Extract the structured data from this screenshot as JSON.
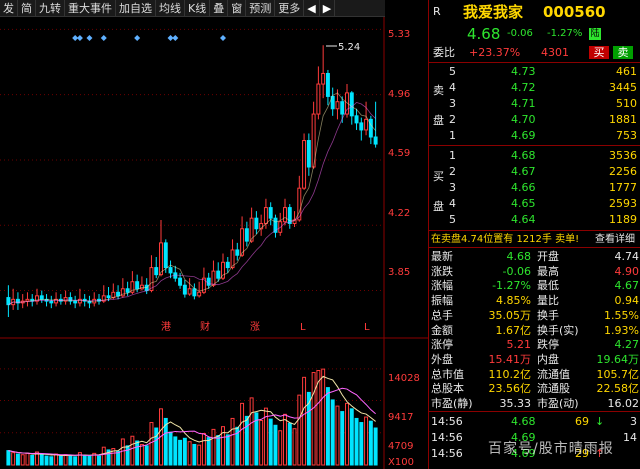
{
  "toolbar": {
    "items": [
      "发",
      "简",
      "九转",
      "重大事件",
      "加自选",
      "均线",
      "K线",
      "叠",
      "窗",
      "预测",
      "更多"
    ],
    "prev_nav": "◀",
    "next_nav": "▶"
  },
  "chart": {
    "price_ticks": [
      "5.33",
      "4.96",
      "4.59",
      "4.22",
      "3.85"
    ],
    "peak_label": "5.24",
    "event_marks": [
      "港",
      "财",
      "涨",
      "L",
      "L"
    ],
    "volume_ticks": [
      "14028",
      "9417",
      "4709",
      "X100"
    ],
    "colors": {
      "up": "#ff3b3b",
      "down": "#00e5ff",
      "grid": "#6b0000",
      "ma": "#f2e6a8",
      "tick": "#ff3b3b",
      "marker": "#5fb0ff"
    }
  },
  "chart_data": {
    "type": "candlestick",
    "ylim": [
      3.7,
      5.4
    ],
    "volume_ylim": [
      0,
      16500
    ],
    "peak": 5.24,
    "candles": [
      [
        3.81,
        3.77,
        3.88,
        3.7,
        2100
      ],
      [
        3.77,
        3.8,
        3.86,
        3.74,
        1800
      ],
      [
        3.8,
        3.78,
        3.84,
        3.74,
        1600
      ],
      [
        3.78,
        3.79,
        3.83,
        3.75,
        1500
      ],
      [
        3.79,
        3.8,
        3.84,
        3.76,
        1700
      ],
      [
        3.8,
        3.79,
        3.83,
        3.76,
        1400
      ],
      [
        3.79,
        3.82,
        3.86,
        3.77,
        1900
      ],
      [
        3.82,
        3.8,
        3.85,
        3.78,
        1500
      ],
      [
        3.8,
        3.79,
        3.83,
        3.76,
        1300
      ],
      [
        3.79,
        3.78,
        3.82,
        3.75,
        1200
      ],
      [
        3.78,
        3.8,
        3.84,
        3.76,
        1600
      ],
      [
        3.8,
        3.79,
        3.83,
        3.77,
        1300
      ],
      [
        3.79,
        3.81,
        3.85,
        3.77,
        1500
      ],
      [
        3.81,
        3.79,
        3.84,
        3.77,
        1400
      ],
      [
        3.79,
        3.78,
        3.82,
        3.75,
        1200
      ],
      [
        3.78,
        3.8,
        3.86,
        3.76,
        1800
      ],
      [
        3.8,
        3.79,
        3.83,
        3.76,
        1400
      ],
      [
        3.79,
        3.78,
        3.82,
        3.75,
        1300
      ],
      [
        3.78,
        3.8,
        3.84,
        3.76,
        1700
      ],
      [
        3.8,
        3.79,
        3.83,
        3.77,
        1300
      ],
      [
        3.79,
        3.82,
        3.88,
        3.78,
        2600
      ],
      [
        3.82,
        3.81,
        3.87,
        3.79,
        2200
      ],
      [
        3.81,
        3.84,
        3.89,
        3.8,
        2400
      ],
      [
        3.84,
        3.82,
        3.88,
        3.8,
        2000
      ],
      [
        3.82,
        3.86,
        3.92,
        3.81,
        3800
      ],
      [
        3.86,
        3.84,
        3.9,
        3.82,
        2800
      ],
      [
        3.84,
        3.9,
        3.96,
        3.83,
        4200
      ],
      [
        3.9,
        3.86,
        3.94,
        3.84,
        3500
      ],
      [
        3.86,
        3.88,
        3.93,
        3.85,
        3000
      ],
      [
        3.88,
        3.85,
        3.92,
        3.83,
        2800
      ],
      [
        3.85,
        3.98,
        4.05,
        3.84,
        6200
      ],
      [
        3.98,
        3.94,
        4.04,
        3.92,
        5400
      ],
      [
        3.94,
        4.12,
        4.25,
        3.93,
        8200
      ],
      [
        4.12,
        3.98,
        4.14,
        3.95,
        6800
      ],
      [
        3.98,
        3.95,
        4.02,
        3.92,
        4800
      ],
      [
        3.95,
        3.92,
        3.99,
        3.9,
        4100
      ],
      [
        3.92,
        3.88,
        3.95,
        3.86,
        3600
      ],
      [
        3.88,
        3.83,
        3.91,
        3.81,
        3900
      ],
      [
        3.83,
        3.86,
        3.92,
        3.82,
        3400
      ],
      [
        3.86,
        3.82,
        3.89,
        3.8,
        3000
      ],
      [
        3.82,
        3.84,
        3.9,
        3.81,
        2900
      ],
      [
        3.84,
        3.92,
        3.98,
        3.83,
        4600
      ],
      [
        3.92,
        3.88,
        3.95,
        3.86,
        4000
      ],
      [
        3.88,
        3.96,
        4.02,
        3.87,
        5200
      ],
      [
        3.96,
        3.92,
        4.01,
        3.9,
        4300
      ],
      [
        3.92,
        4.01,
        4.06,
        3.91,
        5600
      ],
      [
        4.01,
        3.98,
        4.04,
        3.95,
        4400
      ],
      [
        3.98,
        4.08,
        4.14,
        3.97,
        6800
      ],
      [
        4.08,
        4.05,
        4.12,
        4.02,
        5500
      ],
      [
        4.05,
        4.2,
        4.27,
        4.04,
        9000
      ],
      [
        4.2,
        4.13,
        4.24,
        4.1,
        7100
      ],
      [
        4.13,
        4.26,
        4.32,
        4.12,
        9800
      ],
      [
        4.26,
        4.2,
        4.3,
        4.17,
        7600
      ],
      [
        4.2,
        4.23,
        4.28,
        4.16,
        6500
      ],
      [
        4.23,
        4.32,
        4.37,
        4.2,
        8300
      ],
      [
        4.32,
        4.26,
        4.35,
        4.22,
        6700
      ],
      [
        4.26,
        4.18,
        4.28,
        4.15,
        5800
      ],
      [
        4.18,
        4.24,
        4.29,
        4.16,
        5000
      ],
      [
        4.24,
        4.32,
        4.37,
        4.22,
        7400
      ],
      [
        4.32,
        4.23,
        4.34,
        4.2,
        6100
      ],
      [
        4.23,
        4.25,
        4.3,
        4.21,
        5300
      ],
      [
        4.25,
        4.43,
        4.5,
        4.24,
        10200
      ],
      [
        4.43,
        4.7,
        4.74,
        4.42,
        12800
      ],
      [
        4.7,
        4.55,
        4.74,
        4.5,
        10600
      ],
      [
        4.55,
        4.85,
        4.92,
        4.54,
        13500
      ],
      [
        4.85,
        5.02,
        5.12,
        4.82,
        13800
      ],
      [
        5.02,
        5.08,
        5.24,
        4.94,
        14000
      ],
      [
        5.08,
        4.95,
        5.1,
        4.9,
        11300
      ],
      [
        4.95,
        4.88,
        5.0,
        4.84,
        9500
      ],
      [
        4.88,
        4.92,
        4.99,
        4.82,
        8600
      ],
      [
        4.92,
        4.85,
        4.95,
        4.8,
        7800
      ],
      [
        4.85,
        4.97,
        5.02,
        4.83,
        9000
      ],
      [
        4.97,
        4.84,
        4.98,
        4.79,
        8200
      ],
      [
        4.84,
        4.8,
        4.88,
        4.76,
        6800
      ],
      [
        4.8,
        4.76,
        4.83,
        4.7,
        6200
      ],
      [
        4.76,
        4.82,
        4.92,
        4.73,
        7000
      ],
      [
        4.82,
        4.72,
        4.84,
        4.68,
        6400
      ],
      [
        4.72,
        4.68,
        4.92,
        4.66,
        5400
      ]
    ]
  },
  "quote": {
    "r_badge": "R",
    "name": "我爱我家",
    "code": "000560",
    "price": "4.68",
    "change": "-0.06",
    "change_pct": "-1.27%",
    "flag": "陆",
    "weibi_label": "委比",
    "weibi_value": "+23.37%",
    "weibi_diff": "4301",
    "buy_btn": "买",
    "sell_btn": "卖"
  },
  "order_book": {
    "sell_label_1": "卖",
    "sell_label_2": "盘",
    "buy_label_1": "买",
    "buy_label_2": "盘",
    "sell": [
      {
        "level": "5",
        "price": "4.73",
        "vol": "461"
      },
      {
        "level": "4",
        "price": "4.72",
        "vol": "3445"
      },
      {
        "level": "3",
        "price": "4.71",
        "vol": "510"
      },
      {
        "level": "2",
        "price": "4.70",
        "vol": "1881"
      },
      {
        "level": "1",
        "price": "4.69",
        "vol": "753"
      }
    ],
    "buy": [
      {
        "level": "1",
        "price": "4.68",
        "vol": "3536"
      },
      {
        "level": "2",
        "price": "4.67",
        "vol": "2256"
      },
      {
        "level": "3",
        "price": "4.66",
        "vol": "1777"
      },
      {
        "level": "4",
        "price": "4.65",
        "vol": "2593"
      },
      {
        "level": "5",
        "price": "4.64",
        "vol": "1189"
      }
    ]
  },
  "notice": {
    "text": "在卖盘4.74位置有 1212手 卖单!",
    "link": "查看详细"
  },
  "stats": [
    {
      "l1": "最新",
      "v1": "4.68",
      "c1": "green",
      "l2": "开盘",
      "v2": "4.74",
      "c2": "white"
    },
    {
      "l1": "涨跌",
      "v1": "-0.06",
      "c1": "green",
      "l2": "最高",
      "v2": "4.90",
      "c2": "red"
    },
    {
      "l1": "涨幅",
      "v1": "-1.27%",
      "c1": "green",
      "l2": "最低",
      "v2": "4.67",
      "c2": "green"
    },
    {
      "l1": "振幅",
      "v1": "4.85%",
      "c1": "yellow",
      "l2": "量比",
      "v2": "0.94",
      "c2": "yellow"
    },
    {
      "l1": "总手",
      "v1": "35.05万",
      "c1": "yellow",
      "l2": "换手",
      "v2": "1.55%",
      "c2": "yellow"
    },
    {
      "l1": "金额",
      "v1": "1.67亿",
      "c1": "yellow",
      "l2": "换手(实)",
      "v2": "1.93%",
      "c2": "yellow"
    },
    {
      "l1": "涨停",
      "v1": "5.21",
      "c1": "red",
      "l2": "跌停",
      "v2": "4.27",
      "c2": "green"
    },
    {
      "l1": "外盘",
      "v1": "15.41万",
      "c1": "red",
      "l2": "内盘",
      "v2": "19.64万",
      "c2": "green"
    },
    {
      "l1": "总市值",
      "v1": "110.2亿",
      "c1": "yellow",
      "l2": "流通值",
      "v2": "105.7亿",
      "c2": "yellow"
    },
    {
      "l1": "总股本",
      "v1": "23.56亿",
      "c1": "yellow",
      "l2": "流通股",
      "v2": "22.58亿",
      "c2": "yellow"
    },
    {
      "l1": "市盈(静)",
      "v1": "35.33",
      "c1": "white",
      "l2": "市盈(动)",
      "v2": "16.02",
      "c2": "white"
    }
  ],
  "ticks": [
    {
      "time": "14:56",
      "price": "4.68",
      "vol": "69",
      "arrow": "↓",
      "num": "3"
    },
    {
      "time": "14:56",
      "price": "4.69",
      "vol": "",
      "arrow": "",
      "num": "14"
    },
    {
      "time": "14:56",
      "price": "4.69",
      "vol": "29",
      "arrow": "↑",
      "num": ""
    }
  ],
  "watermark": "百家号/股市晴雨报"
}
